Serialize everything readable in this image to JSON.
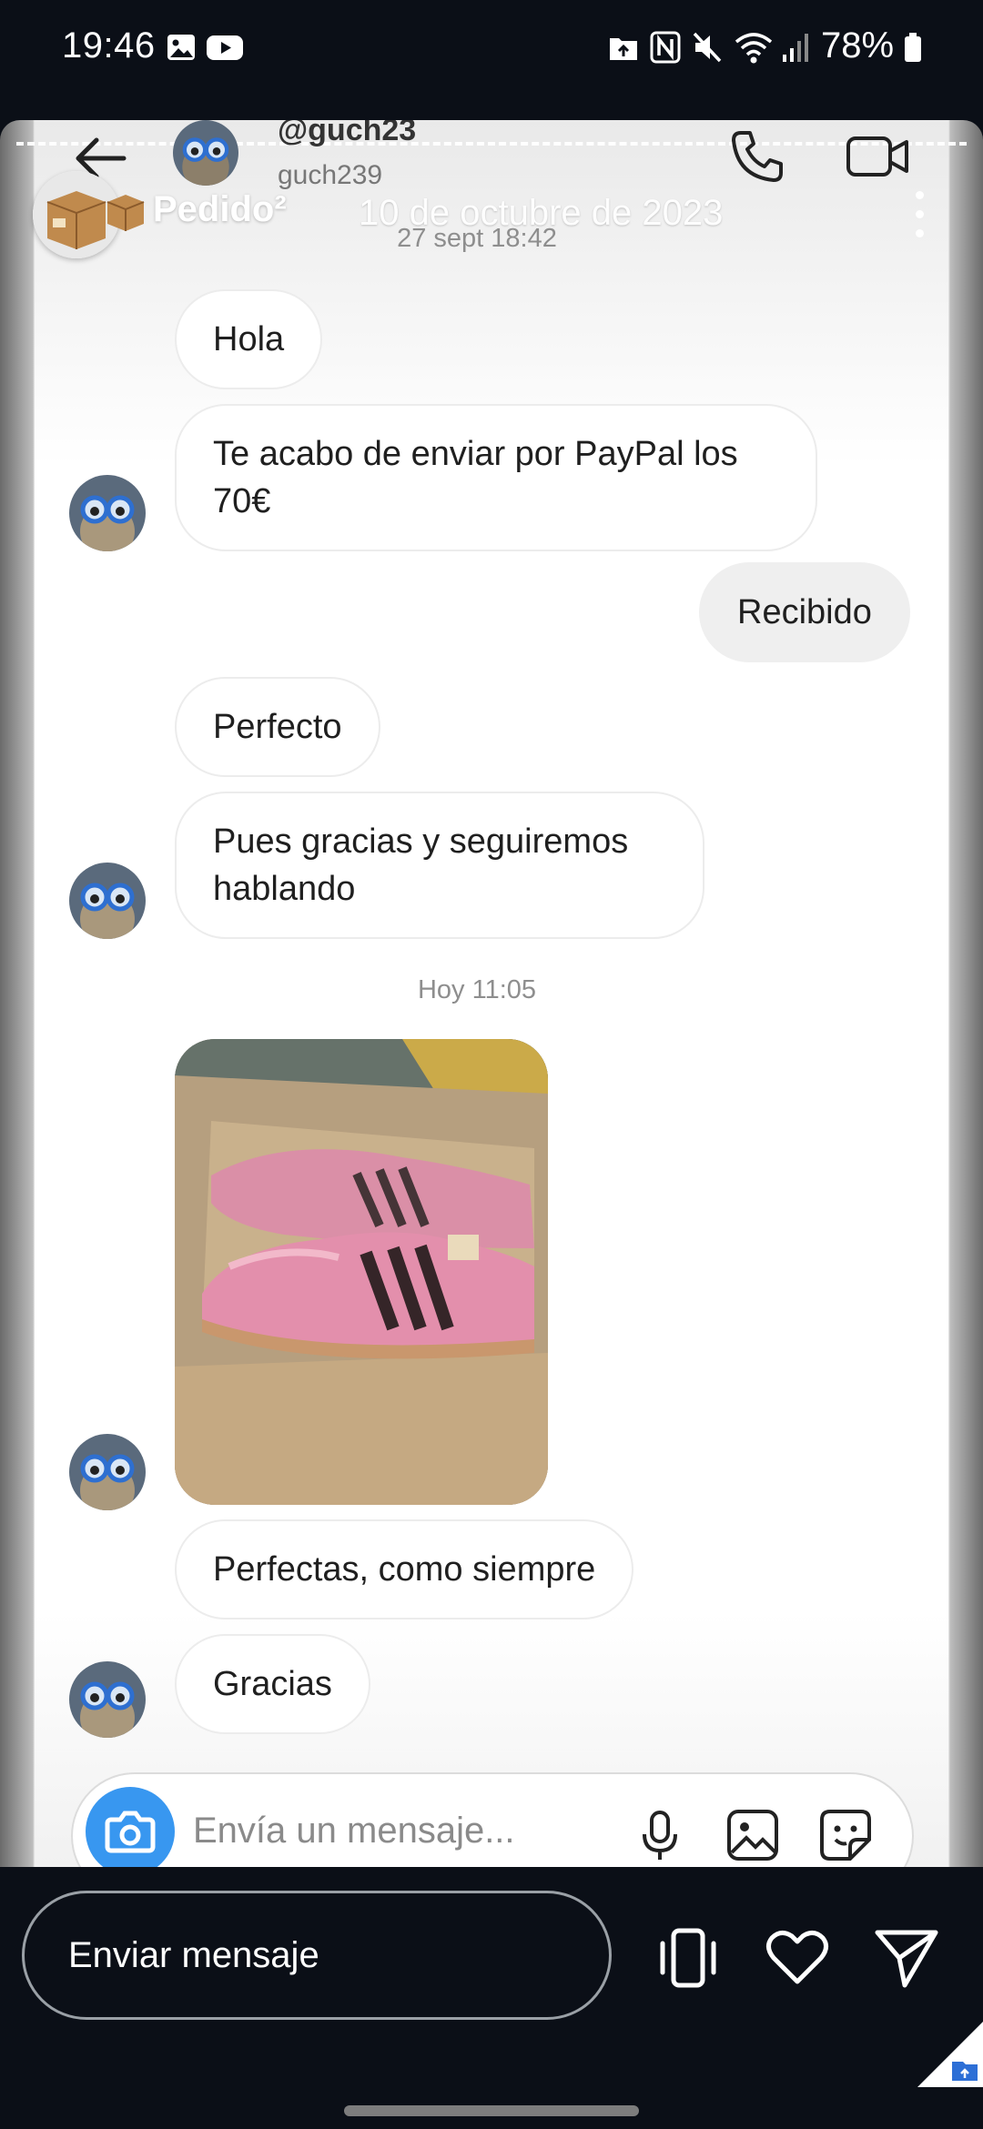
{
  "status_bar": {
    "time": "19:46",
    "battery": "78%"
  },
  "chat": {
    "handle": "@guch23",
    "username": "guch239",
    "messages": [
      {
        "from": "other",
        "text": "Hola"
      },
      {
        "from": "other",
        "text": "Te acabo de enviar por PayPal los 70€"
      },
      {
        "from": "me",
        "text": "Recibido"
      },
      {
        "from": "other",
        "text": "Perfecto"
      },
      {
        "from": "other",
        "text": "Pues gracias y seguiremos hablando"
      },
      {
        "from": "other",
        "text": "Perfectas, como siempre"
      },
      {
        "from": "other",
        "text": "Gracias"
      }
    ],
    "timestamps": [
      "27 sept 18:42",
      "Hoy 11:05"
    ],
    "composer_placeholder": "Envía un mensaje..."
  },
  "story": {
    "title": "Pedido²",
    "date": "10 de octubre de 2023"
  },
  "reply_bar": {
    "send_label": "Enviar mensaje"
  },
  "icons": [
    "back-arrow-icon",
    "phone-icon",
    "video-camera-icon",
    "more-vertical-icon",
    "camera-icon",
    "microphone-icon",
    "gallery-icon",
    "sticker-icon",
    "phone-outline-icon",
    "heart-icon",
    "send-icon"
  ],
  "colors": {
    "accent": "#3897f0",
    "background_dark": "#0b0f17"
  }
}
